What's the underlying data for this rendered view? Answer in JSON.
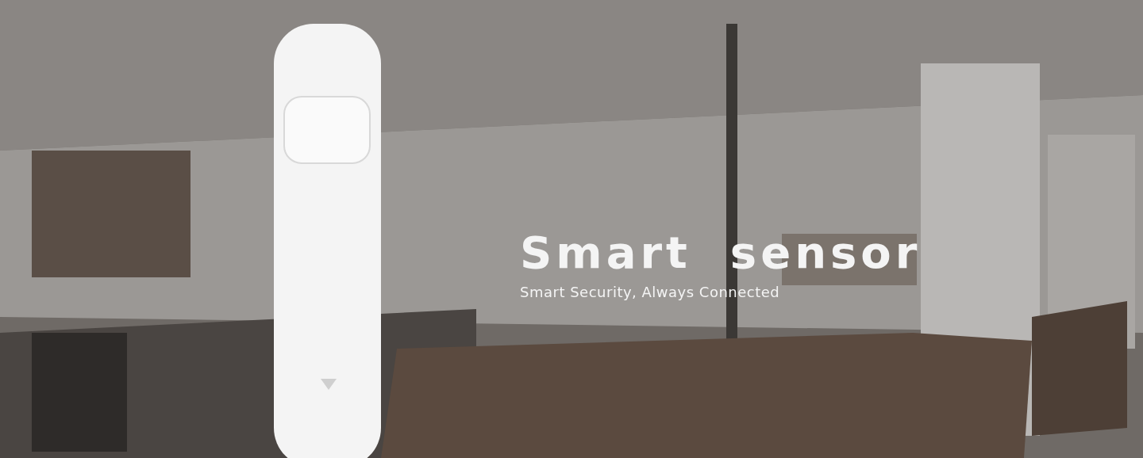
{
  "banner": {
    "title": "Smart  sensor",
    "subtitle": "Smart Security, Always Connected"
  }
}
